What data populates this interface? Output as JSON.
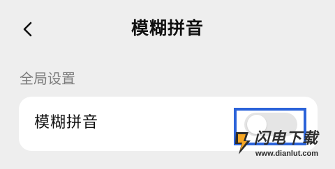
{
  "header": {
    "back_icon": "chevron-left-icon",
    "title": "模糊拼音"
  },
  "section": {
    "label": "全局设置"
  },
  "setting_row": {
    "label": "模糊拼音",
    "toggle_on": false
  },
  "watermark": {
    "title": "闪电下载",
    "url": "www.dianlut.com",
    "logo_icon": "lightning-icon"
  },
  "colors": {
    "background": "#eeeeee",
    "card": "#ffffff",
    "highlight": "#2b63d9",
    "toggle_off": "#e5e5e5",
    "watermark_accent": "#f6a623"
  }
}
